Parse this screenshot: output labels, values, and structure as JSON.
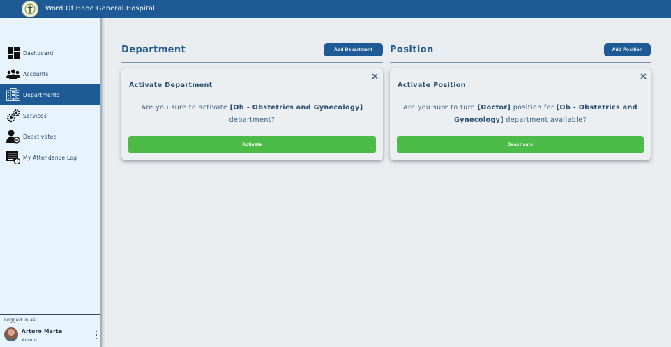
{
  "app": {
    "title": "Word Of Hope General Hospital"
  },
  "sidebar": {
    "items": [
      {
        "label": "Dashboard",
        "icon": "dashboard-icon",
        "active": false
      },
      {
        "label": "Accounts",
        "icon": "users-icon",
        "active": false
      },
      {
        "label": "Departments",
        "icon": "building-icon",
        "active": true
      },
      {
        "label": "Services",
        "icon": "gears-icon",
        "active": false
      },
      {
        "label": "Deactivated",
        "icon": "user-minus-icon",
        "active": false
      },
      {
        "label": "My Attendance Log",
        "icon": "log-icon",
        "active": false
      }
    ],
    "footer": {
      "logged_in_label": "Logged in as:",
      "user_name": "Arturo Marte",
      "user_role": "Admin"
    }
  },
  "department_panel": {
    "title": "Department",
    "add_button": "Add Department",
    "modal": {
      "title": "Activate Department",
      "message_prefix": "Are you sure to activate",
      "message_highlight": "[Ob - Obstetrics and Gynecology]",
      "message_suffix": "department?",
      "button": "Activate"
    }
  },
  "position_panel": {
    "title": "Position",
    "add_button": "Add Position",
    "modal": {
      "title": "Activate Position",
      "message_prefix": "Are you sure to turn",
      "message_position": "[Doctor]",
      "message_middle": "position for",
      "message_department": "[Ob - Obstetrics and Gynecology]",
      "message_suffix": "department available?",
      "button": "Deactivate"
    }
  },
  "colors": {
    "primary": "#1e5a96",
    "success": "#4cbb47",
    "sidebar_bg": "#e8f4fd",
    "content_bg": "#e9edf0"
  }
}
